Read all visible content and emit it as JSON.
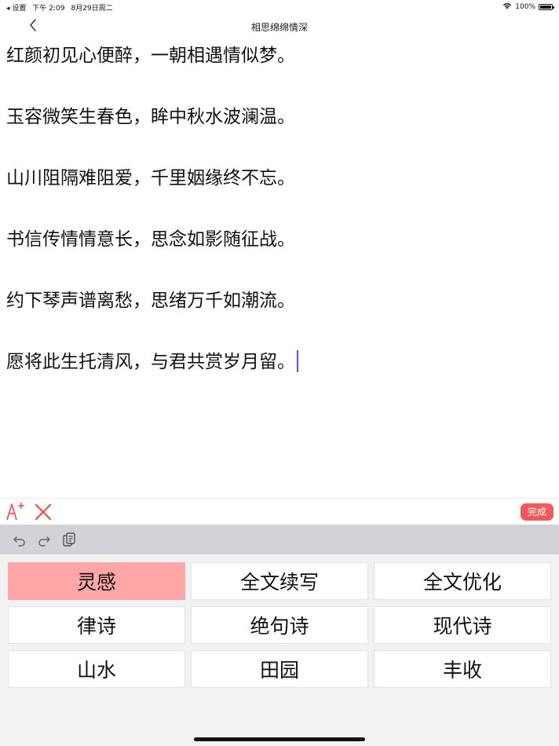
{
  "status_bar": {
    "back_app": "◂ 设置",
    "time": "下午 2:09",
    "date": "8月29日周二",
    "battery": "100%"
  },
  "nav": {
    "title": "相思绵绵情深"
  },
  "poem": {
    "lines": [
      "红颜初见心便醉，一朝相遇情似梦。",
      "玉容微笑生春色，眸中秋水波澜温。",
      "山川阻隔难阻爱，千里姻缘终不忘。",
      "书信传情情意长，思念如影随征战。",
      "约下琴声谱离愁，思绪万千如潮流。",
      "愿将此生托清风，与君共赏岁月留。"
    ]
  },
  "toolbar": {
    "done_label": "完成"
  },
  "suggestions": [
    "灵感",
    "全文续写",
    "全文优化",
    "律诗",
    "绝句诗",
    "现代诗",
    "山水",
    "田园",
    "丰收"
  ],
  "colors": {
    "accent": "#f05a5a",
    "active_cell": "#ffa6a6",
    "caret": "#5b56d6",
    "keyboard_toolbar": "#d1d3d8",
    "keyboard_bg": "#f2f2f4"
  },
  "icons": {
    "back": "chevron-left-icon",
    "font": "font-add-icon",
    "close": "close-icon",
    "undo": "undo-icon",
    "redo": "redo-icon",
    "clipboard": "clipboard-icon",
    "wifi": "wifi-icon",
    "battery": "battery-icon"
  }
}
